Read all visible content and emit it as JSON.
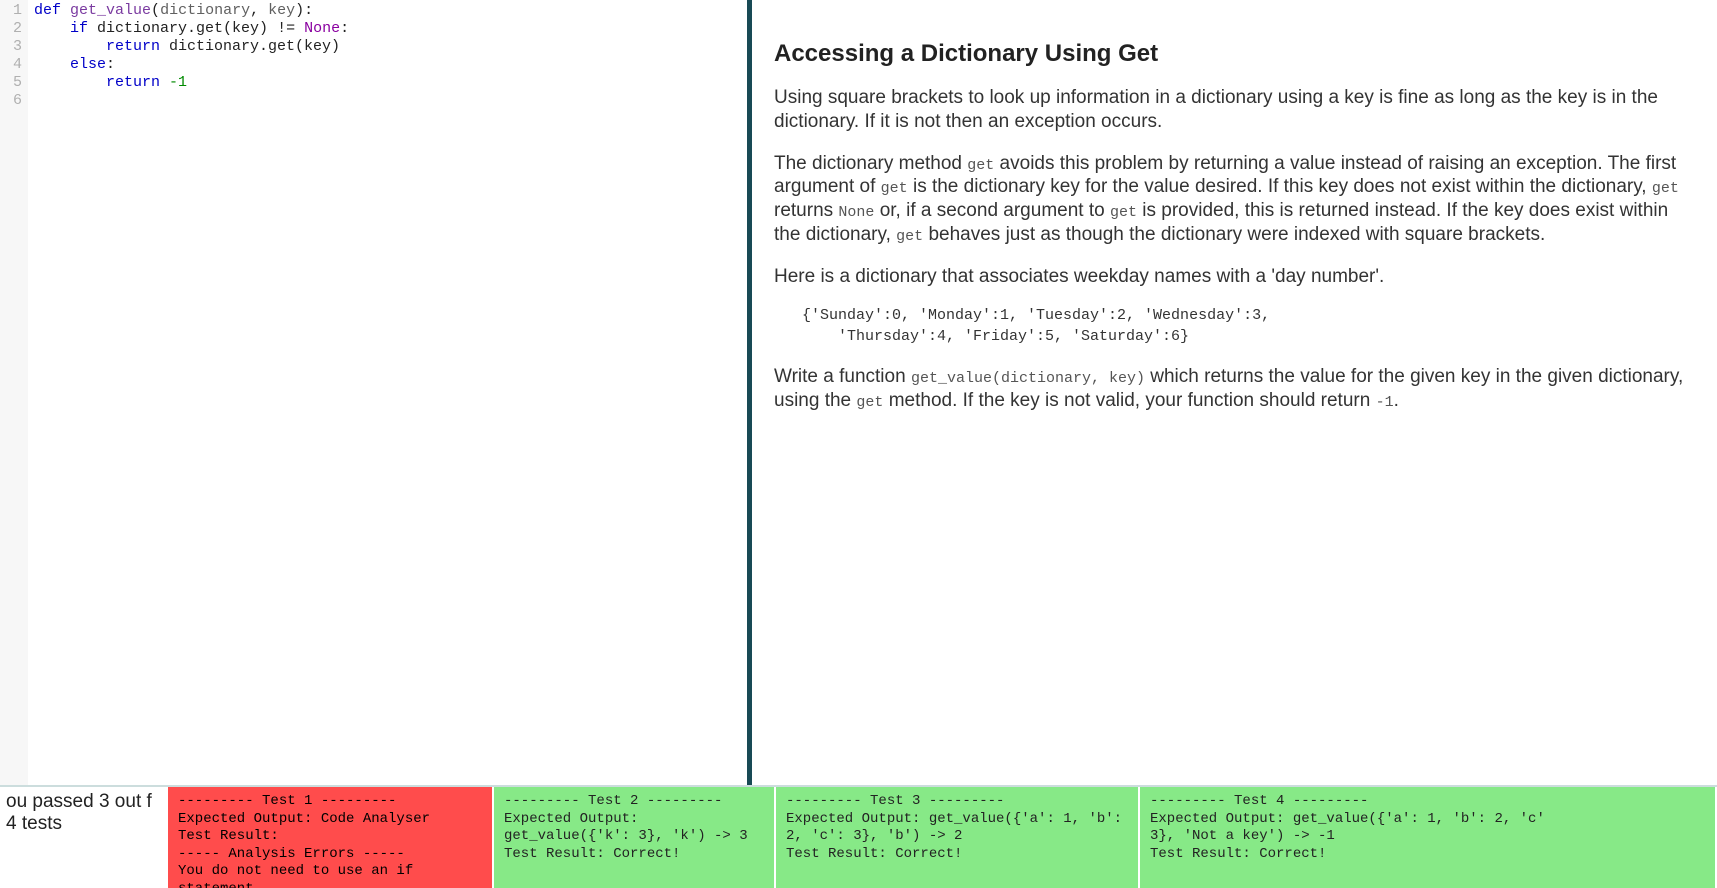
{
  "editor": {
    "line_numbers": [
      "1",
      "2",
      "3",
      "4",
      "5",
      "6"
    ],
    "code_html": "<span class='kw'>def</span> <span class='fn'>get_value</span>(<span class='nm'>dictionary</span>, <span class='nm'>key</span>):\n    <span class='kw'>if</span> dictionary.get(key) <span class='op'>!=</span> <span class='cnst'>None</span>:\n        <span class='kw'>return</span> dictionary.get(key)\n    <span class='kw'>else</span>:\n        <span class='kw'>return</span> <span class='num'>-1</span>\n"
  },
  "instructions": {
    "title": "Accessing a Dictionary Using Get",
    "para1": "Using square brackets to look up information in a dictionary using a key is fine as long as the key is in the dictionary. If it is not then an exception occurs.",
    "para2_a": "The dictionary method ",
    "para2_b": " avoids this problem by returning a value instead of raising an exception. The first argument of ",
    "para2_c": " is the dictionary key for the value desired. If this key does not exist within the dictionary, ",
    "para2_d": " returns ",
    "para2_e": " or, if a second argument to ",
    "para2_f": " is provided, this is returned instead. If the key does exist within the dictionary, ",
    "para2_g": " behaves just as though the dictionary were indexed with square brackets.",
    "code_get": "get",
    "code_none": "None",
    "para3": "Here is a dictionary that associates weekday names with a 'day number'.",
    "snippet": "{'Sunday':0, 'Monday':1, 'Tuesday':2, 'Wednesday':3,\n    'Thursday':4, 'Friday':5, 'Saturday':6}",
    "para4_a": "Write a function ",
    "code_sig": "get_value(dictionary, key)",
    "para4_b": " which returns the value for the given key in the given dictionary, using the ",
    "para4_c": " method. If the key is not valid, your function should return ",
    "code_neg1": "-1",
    "para4_d": "."
  },
  "results": {
    "summary": "ou passed 3 out f 4 tests",
    "tests": [
      {
        "status": "fail",
        "text": "--------- Test 1 ---------\nExpected Output: Code Analyser\nTest Result:\n----- Analysis Errors -----\nYou do not need to use an if statement"
      },
      {
        "status": "pass",
        "text": "--------- Test 2 ---------\nExpected Output:\nget_value({'k': 3}, 'k') -> 3\nTest Result: Correct!"
      },
      {
        "status": "pass",
        "text": "--------- Test 3 ---------\nExpected Output: get_value({'a': 1, 'b':\n2, 'c': 3}, 'b') -> 2\nTest Result: Correct!"
      },
      {
        "status": "pass",
        "text": "--------- Test 4 ---------\nExpected Output: get_value({'a': 1, 'b': 2, 'c'\n3}, 'Not a key') -> -1\nTest Result: Correct!"
      }
    ]
  }
}
